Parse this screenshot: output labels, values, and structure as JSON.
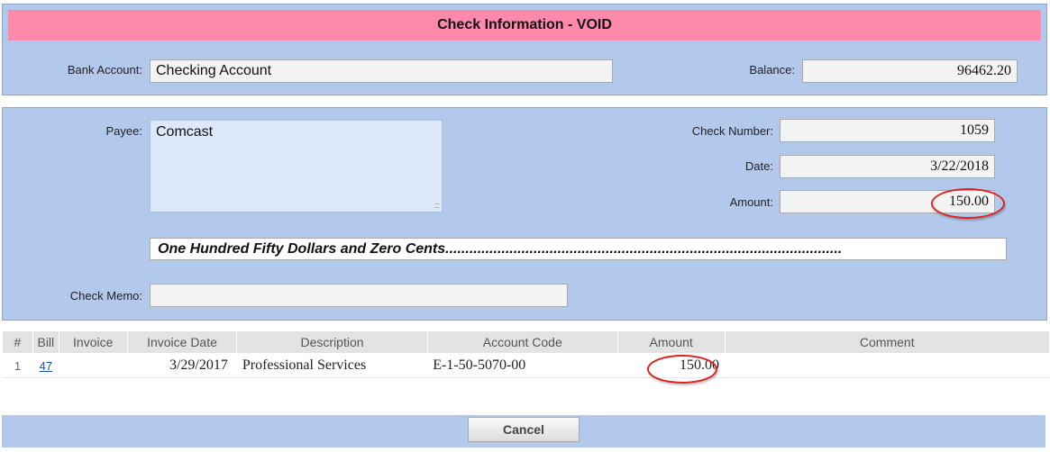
{
  "header": {
    "title": "Check Information - VOID"
  },
  "account": {
    "bank_account_label": "Bank Account:",
    "bank_account_value": "Checking Account",
    "balance_label": "Balance:",
    "balance_value": "96462.20"
  },
  "check": {
    "payee_label": "Payee:",
    "payee_value": "Comcast",
    "check_number_label": "Check Number:",
    "check_number_value": "1059",
    "date_label": "Date:",
    "date_value": "3/22/2018",
    "amount_label": "Amount:",
    "amount_value": "150.00",
    "amount_words": "One Hundred Fifty Dollars and Zero Cents...................................................................................................",
    "memo_label": "Check Memo:",
    "memo_value": ""
  },
  "table": {
    "headers": [
      "#",
      "Bill",
      "Invoice",
      "Invoice Date",
      "Description",
      "Account Code",
      "Amount",
      "Comment"
    ],
    "rows": [
      {
        "num": "1",
        "bill": "47",
        "invoice": "",
        "invoice_date": "3/29/2017",
        "description": "Professional Services",
        "account_code": "E-1-50-5070-00",
        "amount": "150.00",
        "comment": ""
      }
    ]
  },
  "buttons": {
    "cancel": "Cancel"
  },
  "colors": {
    "title_bar": "#ff88ad",
    "panel": "#b3c9ec",
    "highlight_circle": "#dd2222"
  }
}
